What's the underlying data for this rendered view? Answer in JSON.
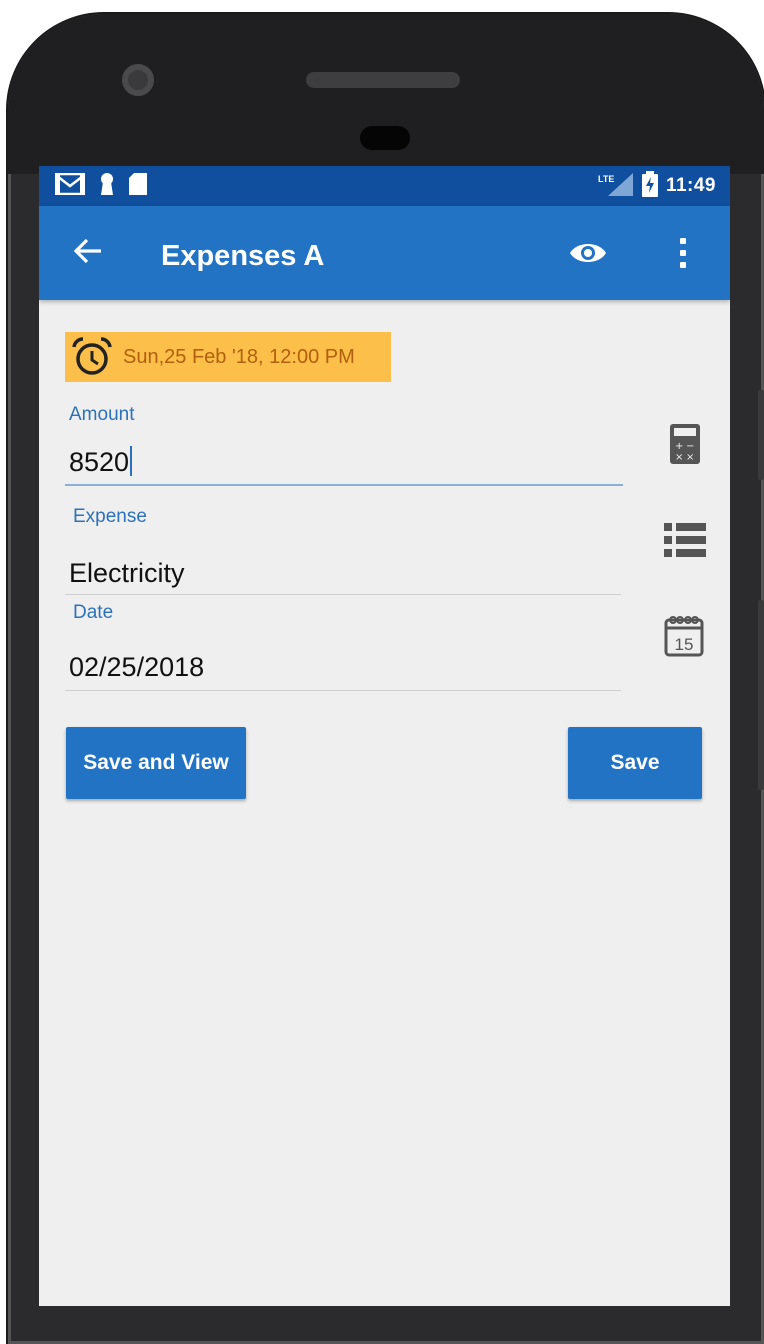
{
  "status_bar": {
    "time": "11:49",
    "left_icons": [
      "gmail-icon",
      "keyhole-icon",
      "sd-card-icon"
    ],
    "right_icons": [
      "lte-signal-icon",
      "battery-charging-icon"
    ]
  },
  "app_bar": {
    "title": "Expenses A",
    "actions": [
      "back-arrow-icon",
      "eye-icon",
      "more-vert-icon"
    ]
  },
  "reminder": {
    "text": "Sun,25 Feb '18, 12:00 PM",
    "icon": "alarm-clock-icon"
  },
  "form": {
    "amount": {
      "label": "Amount",
      "value": "8520"
    },
    "expense": {
      "label": "Expense",
      "value": "Electricity"
    },
    "date": {
      "label": "Date",
      "value": "02/25/2018"
    }
  },
  "side_icons": [
    "calculator-icon",
    "list-icon",
    "calendar-icon"
  ],
  "calendar_day": "15",
  "buttons": {
    "save_and_view": "Save and View",
    "save": "Save"
  },
  "colors": {
    "status_bar": "#0f4f9d",
    "app_bar": "#2273c4",
    "reminder_bg": "#fcc04a",
    "label": "#2d72b8"
  }
}
